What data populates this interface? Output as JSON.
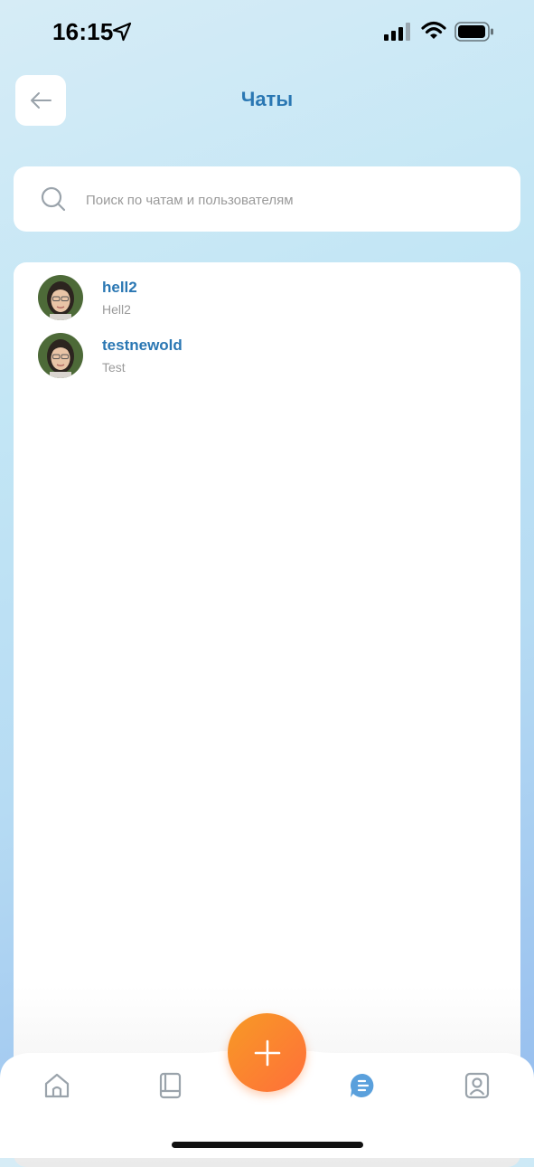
{
  "status_bar": {
    "time": "16:15"
  },
  "header": {
    "title": "Чаты",
    "back_icon": "arrow-left-icon"
  },
  "search": {
    "placeholder": "Поиск по чатам и пользователям",
    "value": ""
  },
  "chats": [
    {
      "name": "hell2",
      "preview": "Hell2"
    },
    {
      "name": "testnewold",
      "preview": "Test"
    }
  ],
  "bottom_nav": {
    "items": [
      "home-icon",
      "book-icon",
      "chat-icon",
      "profile-icon"
    ],
    "active": "chat-icon",
    "fab_icon": "plus-icon"
  },
  "colors": {
    "accent": "#2a77b3",
    "fab": "#f98a2e",
    "active_nav": "#5aa0dc"
  }
}
